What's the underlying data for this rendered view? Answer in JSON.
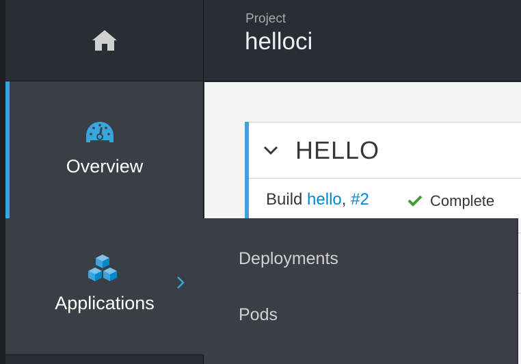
{
  "header": {
    "project_label": "Project",
    "project_name": "helloci",
    "home_icon": "home-icon"
  },
  "nav": {
    "overview": {
      "label": "Overview",
      "icon": "dashboard-icon",
      "active": true
    },
    "applications": {
      "label": "Applications",
      "icon": "cubes-icon",
      "expanded": true
    },
    "flyout_items": [
      "Deployments",
      "Pods"
    ]
  },
  "card": {
    "title": "HELLO",
    "build_prefix": "Build",
    "build_name": "hello",
    "build_separator": ",",
    "build_number": "#2",
    "status": "Complete",
    "status_icon": "check-icon"
  },
  "colors": {
    "accent": "#39a5dc",
    "link": "#0088ce",
    "success": "#3f9c35",
    "nav_bg": "#393f44",
    "header_bg": "#292e34"
  }
}
